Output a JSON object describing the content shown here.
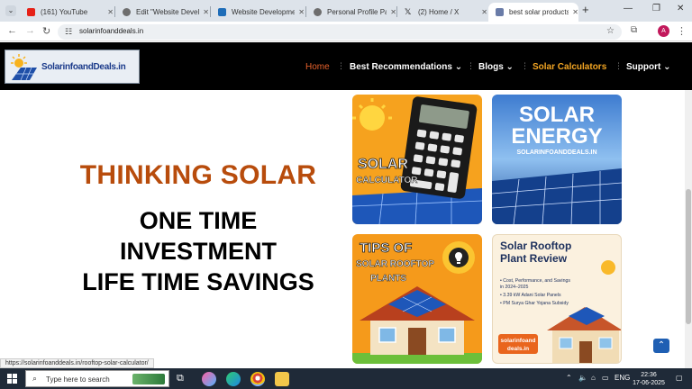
{
  "browser": {
    "tabs": [
      {
        "title": "(161) YouTube",
        "fav": "#e62117"
      },
      {
        "title": "Edit \"Website Develop",
        "fav": "#5a5a5a"
      },
      {
        "title": "Website Development",
        "fav": "#1e6db8"
      },
      {
        "title": "Personal Profile Page",
        "fav": "#5a5a5a"
      },
      {
        "title": "(2) Home / X",
        "fav": "#000000"
      },
      {
        "title": "best solar products fo",
        "fav": "#6a7ca8"
      }
    ],
    "new_tab": "+",
    "url": "solarinfoanddeals.in",
    "profile_initial": "A"
  },
  "site": {
    "logo_text": "SolarinfoandDeals.in",
    "nav": [
      {
        "label": "Home",
        "color": "#e8622c"
      },
      {
        "label": "Best Recommendations ⌄",
        "color": "#ffffff"
      },
      {
        "label": "Blogs ⌄",
        "color": "#ffffff"
      },
      {
        "label": "Solar Calculators",
        "color": "#f4a623"
      },
      {
        "label": "Support ⌄",
        "color": "#ffffff"
      }
    ]
  },
  "hero": {
    "title": "THINKING SOLAR",
    "lines": [
      "ONE TIME",
      "INVESTMENT",
      "LIFE TIME SAVINGS"
    ]
  },
  "cards": {
    "calc": {
      "line1": "SOLAR",
      "line2": "CALCULATOR"
    },
    "energy": {
      "line1": "SOLAR",
      "line2": "ENERGY",
      "site": "SOLARINFOANDDEALS.IN"
    },
    "tips": {
      "line1": "TIPS OF",
      "line2": "SOLAR ROOFTOP",
      "line3": "PLANTS"
    },
    "review": {
      "line1": "Solar Rooftop",
      "line2": "Plant Review",
      "bullets": [
        "• Cost, Performance, and Savings",
        "  in 2024–2025",
        "• 3.39 kW Adani Solar Panels",
        "• PM Surya Ghar Yojana Subsidy"
      ],
      "badge1": "solarinfoand",
      "badge2": "deals.in"
    }
  },
  "status_url": "https://solarinfoanddeals.in/rooftop-solar-calculator/",
  "taskbar": {
    "search_placeholder": "Type here to search",
    "lang": "ENG",
    "time": "22:36",
    "date": "17-06-2025"
  }
}
